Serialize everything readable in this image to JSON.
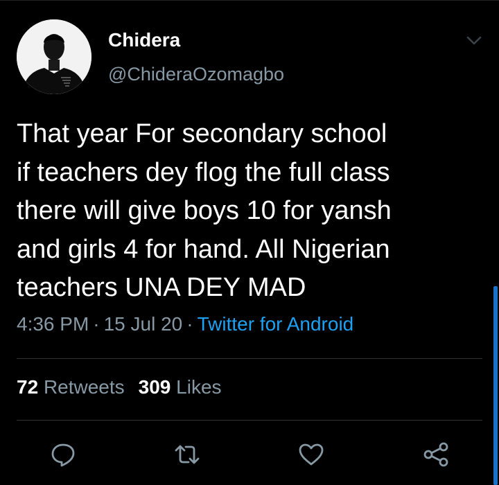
{
  "tweet": {
    "display_name": "Chidera",
    "handle": "@ChideraOzomagbo",
    "text_lines": [
      "That year For secondary school",
      "if teachers dey flog the full class",
      "there will give boys 10 for yansh",
      "and girls 4 for hand. All Nigerian",
      "teachers UNA DEY MAD"
    ],
    "time": "4:36 PM",
    "date": "15 Jul 20",
    "separator": "·",
    "source": "Twitter for Android"
  },
  "stats": {
    "retweets_count": "72",
    "retweets_label": "Retweets",
    "likes_count": "309",
    "likes_label": "Likes"
  },
  "actions": [
    {
      "icon": "reply-icon"
    },
    {
      "icon": "retweet-icon"
    },
    {
      "icon": "like-icon"
    },
    {
      "icon": "share-icon"
    }
  ],
  "colors": {
    "background": "#000000",
    "text": "#ffffff",
    "secondary": "#8899a6",
    "link": "#1da1f2",
    "divider": "#2f3336"
  }
}
